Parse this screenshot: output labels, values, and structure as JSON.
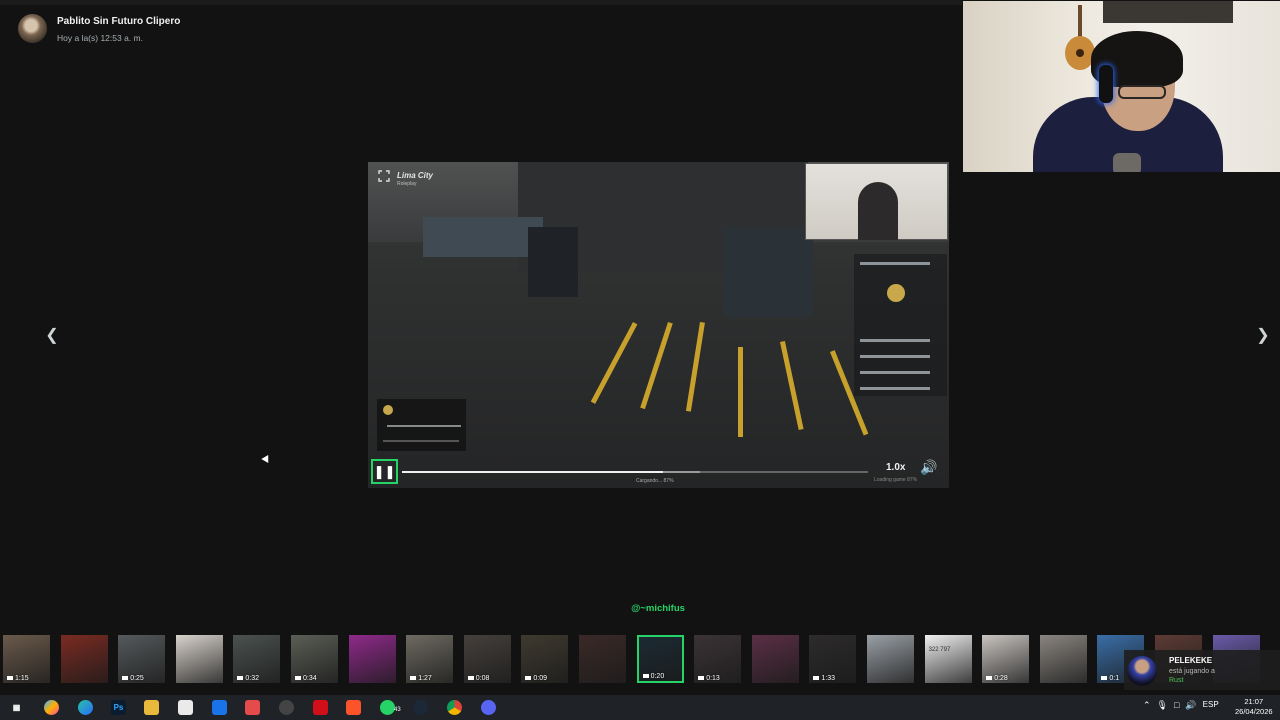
{
  "chat_header": {
    "sender": "Pablito Sin Futuro Clipero",
    "time": "Hoy a la(s) 12:53 a. m."
  },
  "viewer": {
    "nav_prev_icon": "chevron-left-icon",
    "nav_next_icon": "chevron-right-icon",
    "caption": "@~michifus"
  },
  "video": {
    "game_title": "Lima City",
    "game_subtitle": "Roleplay",
    "speed": "1.0x",
    "load_text": "Cargando... 87%",
    "load_status": "Loading game 87%",
    "progress_fraction": 0.56,
    "buffered_fraction": 0.64,
    "play_state": "paused-icon",
    "accent": "#25d366"
  },
  "thumbnails": [
    {
      "duration": "1:15",
      "color": "#6b5a4b",
      "active": false
    },
    {
      "duration": "",
      "color": "#7a2b22",
      "active": false
    },
    {
      "duration": "0:25",
      "color": "#555a5c",
      "active": false
    },
    {
      "duration": "",
      "color": "#d8d2cc",
      "active": false
    },
    {
      "duration": "0:32",
      "color": "#4b524f",
      "active": false
    },
    {
      "duration": "0:34",
      "color": "#5a5e55",
      "active": false
    },
    {
      "duration": "",
      "color": "#8f2a8a",
      "active": false
    },
    {
      "duration": "1:27",
      "color": "#6e6a62",
      "active": false
    },
    {
      "duration": "0:08",
      "color": "#45403c",
      "active": false
    },
    {
      "duration": "0:09",
      "color": "#3f3a30",
      "active": false
    },
    {
      "duration": "",
      "color": "#3a2a28",
      "active": false
    },
    {
      "duration": "0:20",
      "color": "#1c2a33",
      "active": true
    },
    {
      "duration": "0:13",
      "color": "#3b3335",
      "active": false
    },
    {
      "duration": "",
      "color": "#5a2f45",
      "active": false
    },
    {
      "duration": "1:33",
      "color": "#2d2b2b",
      "active": false
    },
    {
      "duration": "",
      "color": "#9aa0a6",
      "active": false
    },
    {
      "duration": "",
      "color": "#f0f0f0",
      "active": false,
      "label": "322 797"
    },
    {
      "duration": "0:28",
      "color": "#c9c4c0",
      "active": false
    },
    {
      "duration": "",
      "color": "#8a8580",
      "active": false
    },
    {
      "duration": "0:1",
      "color": "#3a6ea8",
      "active": false
    },
    {
      "duration": "",
      "color": "#5d3b34",
      "active": false
    },
    {
      "duration": "",
      "color": "#6a5aa8",
      "active": false
    }
  ],
  "notification": {
    "name": "PELEKEKE",
    "line": "está jugando a",
    "game": "Rust"
  },
  "taskbar": {
    "icons": [
      "windows-start-icon",
      "copilot-icon",
      "edge-icon",
      "photoshop-icon",
      "file-explorer-icon",
      "store-icon",
      "outlook-icon",
      "app-icon",
      "clock-app-icon",
      "opera-icon",
      "brave-icon",
      "whatsapp-icon",
      "steam-icon",
      "chrome-icon",
      "discord-icon"
    ],
    "whatsapp_badge": "43",
    "lang": "ESP",
    "time": "21:07",
    "date": "26/04/2026"
  }
}
